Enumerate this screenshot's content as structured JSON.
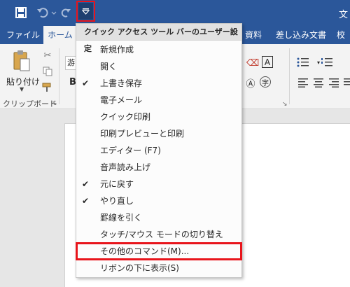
{
  "window": {
    "title_partial": "文"
  },
  "quick_access": {
    "save_icon": "save-icon",
    "undo_icon": "undo-icon",
    "redo_icon": "redo-icon",
    "customize_icon": "customize-dropdown-icon"
  },
  "tabs": [
    {
      "label": "ファイル"
    },
    {
      "label": "ホーム"
    },
    {
      "label": "資料"
    },
    {
      "label": "差し込み文書"
    },
    {
      "label": "校"
    }
  ],
  "ribbon": {
    "paste_label": "貼り付け",
    "clipboard_group_label": "クリップボード",
    "font_name_partial": "游",
    "bold_label": "B",
    "font_box_a": "A",
    "furigana_char": "字"
  },
  "menu": {
    "header": "クイック アクセス ツール バーのユーザー設定",
    "items": [
      {
        "label": "新規作成",
        "checked": false
      },
      {
        "label": "開く",
        "checked": false
      },
      {
        "label": "上書き保存",
        "checked": true
      },
      {
        "label": "電子メール",
        "checked": false
      },
      {
        "label": "クイック印刷",
        "checked": false
      },
      {
        "label": "印刷プレビューと印刷",
        "checked": false
      },
      {
        "label": "エディター (F7)",
        "checked": false
      },
      {
        "label": "音声読み上げ",
        "checked": false
      },
      {
        "label": "元に戻す",
        "checked": true
      },
      {
        "label": "やり直し",
        "checked": true
      },
      {
        "label": "罫線を引く",
        "checked": false
      },
      {
        "label": "タッチ/マウス モードの切り替え",
        "checked": false
      },
      {
        "label": "その他のコマンド(M)...",
        "checked": false,
        "highlighted": true
      },
      {
        "label": "リボンの下に表示(S)",
        "checked": false
      }
    ],
    "check_glyph": "✔"
  },
  "colors": {
    "title_bar": "#2b579a",
    "highlight": "#e8141b"
  }
}
